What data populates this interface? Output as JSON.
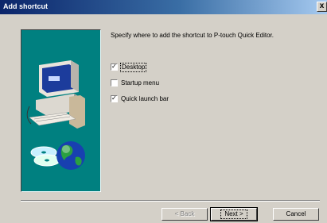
{
  "dialog": {
    "title": "Add shortcut",
    "close_glyph": "x",
    "instruction": "Specify where to add the shortcut to P-touch Quick Editor.",
    "options": [
      {
        "label": "Desktop",
        "checked": true
      },
      {
        "label": "Startup menu",
        "checked": false
      },
      {
        "label": "Quick launch bar",
        "checked": true
      }
    ],
    "check_glyph": "✓",
    "buttons": {
      "back": "< Back",
      "next": "Next >",
      "cancel": "Cancel"
    }
  },
  "colors": {
    "art_background": "#008080",
    "title_start": "#0a246a",
    "dialog_face": "#d4d0c8"
  },
  "icons": [
    "computer-illustration",
    "globe-cd-illustration",
    "close-icon",
    "checkbox-checked-icon"
  ]
}
